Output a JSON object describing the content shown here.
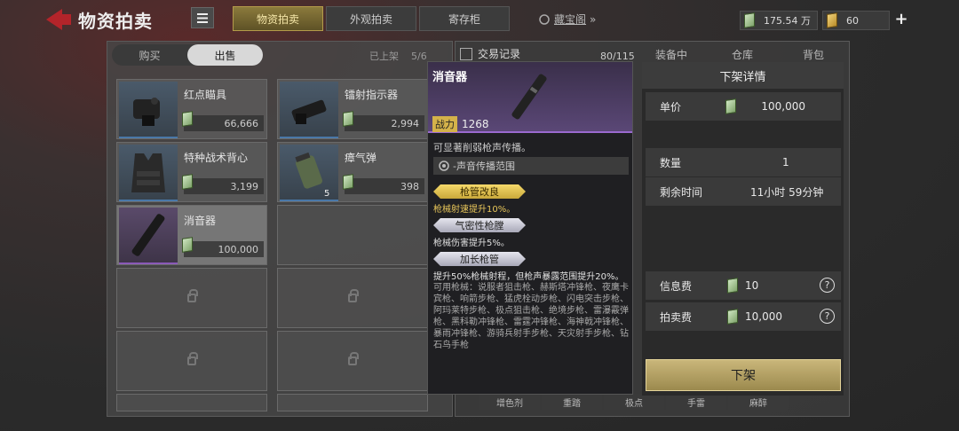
{
  "header": {
    "title": "物资拍卖",
    "menu_icon": "list-icon",
    "tabs": [
      {
        "label": "物资拍卖",
        "active": true
      },
      {
        "label": "外观拍卖",
        "active": false
      },
      {
        "label": "寄存柜",
        "active": false
      }
    ],
    "hidden_link": "藏宝阁",
    "hidden_link_arrows": "»",
    "silver_balance": "175.54 万",
    "gold_balance": "60",
    "plus_label": "+"
  },
  "left": {
    "segments": [
      "购买",
      "出售"
    ],
    "active_segment": "出售",
    "listed_label": "已上架",
    "listed_value": "5/6",
    "items": [
      {
        "name": "红点瞄具",
        "price": "66,666",
        "count": ""
      },
      {
        "name": "镭射指示器",
        "price": "2,994",
        "count": ""
      },
      {
        "name": "特种战术背心",
        "price": "3,199",
        "count": ""
      },
      {
        "name": "瘴气弹",
        "price": "398",
        "count": "5"
      },
      {
        "name": "消音器",
        "price": "100,000",
        "count": ""
      }
    ]
  },
  "middle": {
    "records_label": "交易记录",
    "storage_count": "80/115",
    "tabs": [
      "装备中",
      "仓库",
      "背包"
    ],
    "bottom_tabs": [
      "增色剂",
      "重踏",
      "极点",
      "手雷",
      "麻醉"
    ]
  },
  "tooltip": {
    "name": "消音器",
    "power_label": "战力",
    "power_value": "1268",
    "desc": "可显著削弱枪声传播。",
    "tag": "-声音传播范围",
    "attachments": [
      {
        "name": "枪管改良",
        "effect": "枪械射速提升10%。",
        "style": "gold"
      },
      {
        "name": "气密性枪膛",
        "effect": "枪械伤害提升5%。",
        "style": "silver"
      },
      {
        "name": "加长枪管",
        "effect": "提升50%枪械射程，但枪声暴露范围提升20%。",
        "style": "silver"
      }
    ],
    "usable": "可用枪械：说服者狙击枪、赫斯塔冲锋枪、夜鹰卡宾枪、响箭步枪、猛虎栓动步枪、闪电突击步枪、阿玛莱特步枪、极点狙击枪、绝境步枪、雷瀑霰弹枪、黑科勒冲锋枪、雷霆冲锋枪、海神戟冲锋枪、暴雨冲锋枪、游骑兵射手步枪、天灾射手步枪、钻石鸟手枪"
  },
  "detail": {
    "title": "下架详情",
    "unit_price_label": "单价",
    "unit_price": "100,000",
    "qty_label": "数量",
    "qty": "1",
    "time_label": "剩余时间",
    "time": "11小时 59分钟",
    "info_fee_label": "信息费",
    "info_fee": "10",
    "auction_fee_label": "拍卖费",
    "auction_fee": "10,000",
    "help_mark": "?",
    "button": "下架"
  }
}
